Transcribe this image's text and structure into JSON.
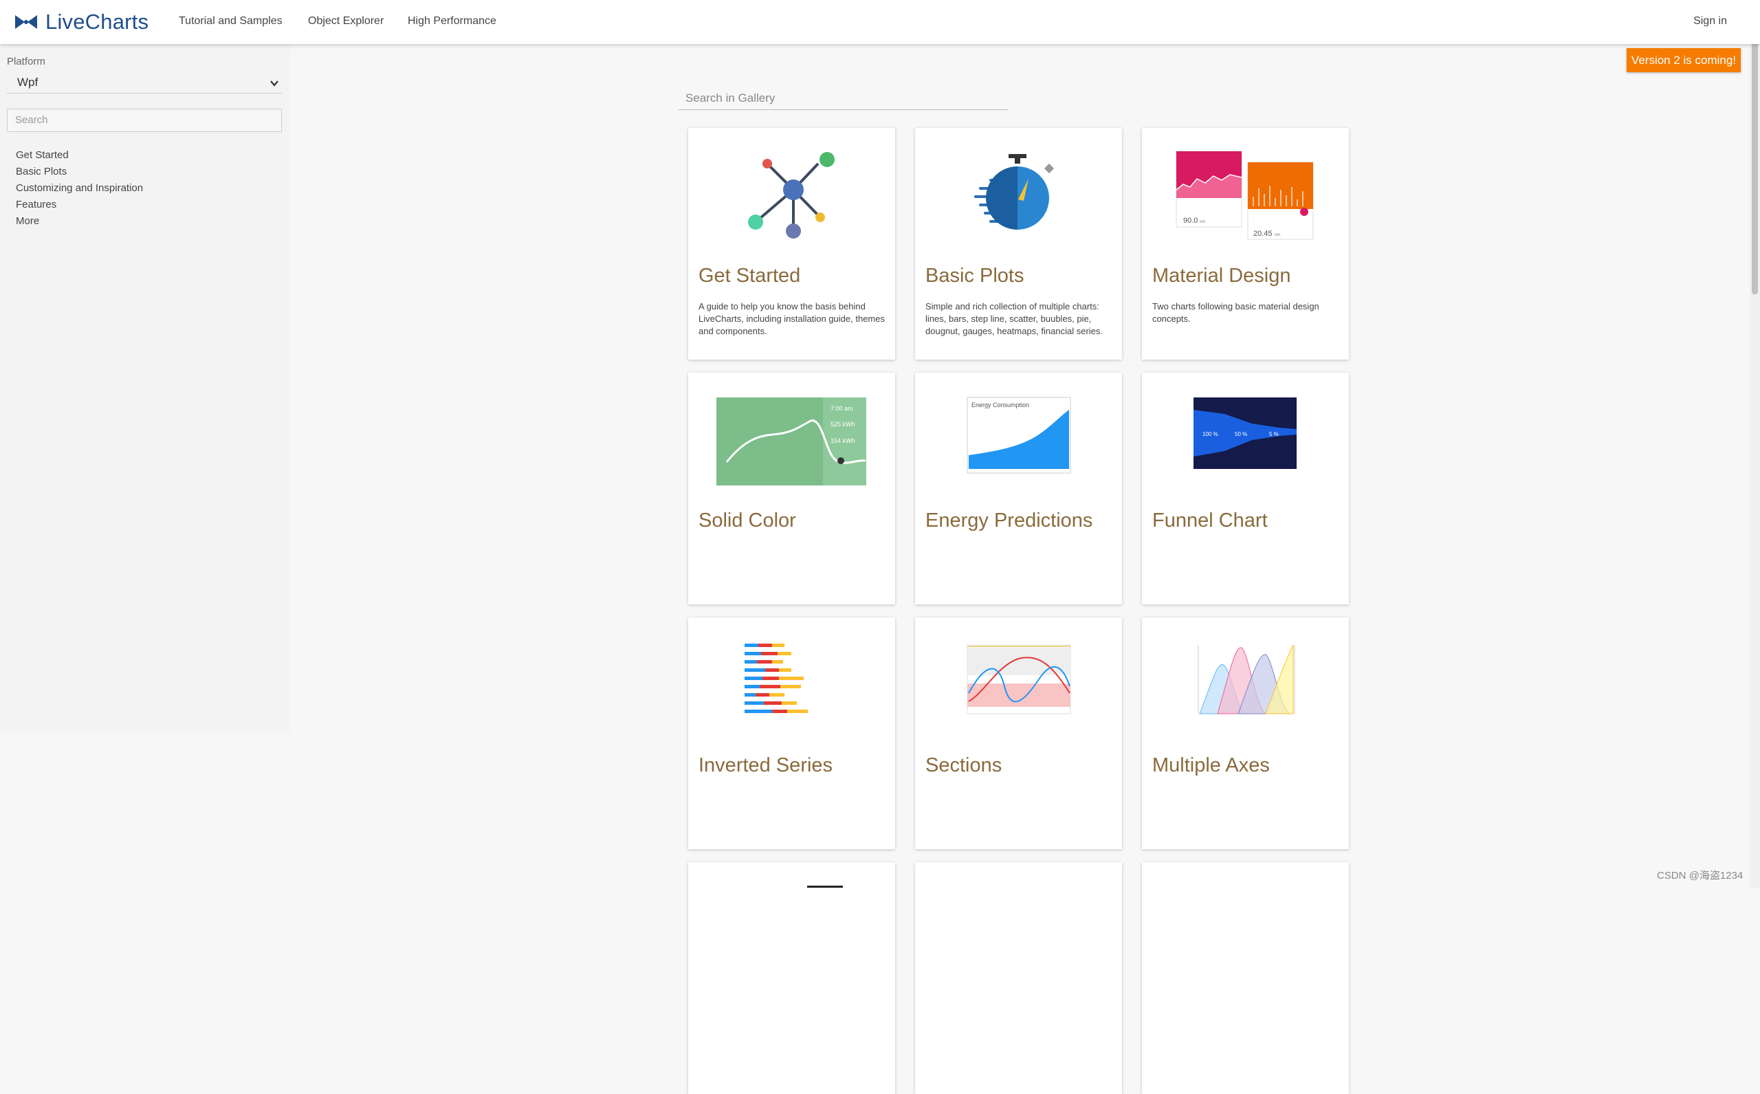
{
  "nav": {
    "brand": "LiveCharts",
    "links": [
      "Tutorial and Samples",
      "Object Explorer",
      "High Performance"
    ],
    "signin": "Sign in"
  },
  "sidebar": {
    "platform_label": "Platform",
    "platform_value": "Wpf",
    "search_placeholder": "Search",
    "items": [
      "Get Started",
      "Basic Plots",
      "Customizing and Inspiration",
      "Features",
      "More"
    ]
  },
  "badge": "Version 2 is coming!",
  "gallery": {
    "search_placeholder": "Search in Gallery",
    "cards": [
      {
        "title": "Get Started",
        "desc": "A guide to help you know the basis behind LiveCharts, including installation guide, themes and components.",
        "icon": "network-icon"
      },
      {
        "title": "Basic Plots",
        "desc": "Simple and rich collection of multiple charts: lines, bars, step line, scatter, buubles, pie, dougnut, gauges, heatmaps, financial series.",
        "icon": "stopwatch-icon"
      },
      {
        "title": "Material Design",
        "desc": "Two charts following basic material design concepts.",
        "icon": "material-charts-thumbnail"
      },
      {
        "title": "Solid Color",
        "desc": "",
        "icon": "solid-color-thumbnail"
      },
      {
        "title": "Energy Predictions",
        "desc": "",
        "icon": "energy-thumbnail"
      },
      {
        "title": "Funnel Chart",
        "desc": "",
        "icon": "funnel-thumbnail"
      },
      {
        "title": "Inverted Series",
        "desc": "",
        "icon": "inverted-series-thumbnail"
      },
      {
        "title": "Sections",
        "desc": "",
        "icon": "sections-thumbnail"
      },
      {
        "title": "Multiple Axes",
        "desc": "",
        "icon": "multiple-axes-thumbnail"
      }
    ]
  },
  "thumb_text": {
    "material_left_value": "90.0",
    "material_left_unit": "cm",
    "material_right_value": "20.45",
    "material_right_unit": "cm",
    "solid_time": "7:00 am",
    "solid_kwh1": "525 kWh",
    "solid_kwh2": "154 kWh",
    "energy_title": "Energy Consumption",
    "funnel_p1": "100 %",
    "funnel_p2": "50 %",
    "funnel_p3": "5 %"
  },
  "watermark": "CSDN @海盗1234",
  "colors": {
    "brand": "#1f4e8c",
    "badge": "#f57c00",
    "card_title": "#8a6a3c"
  }
}
